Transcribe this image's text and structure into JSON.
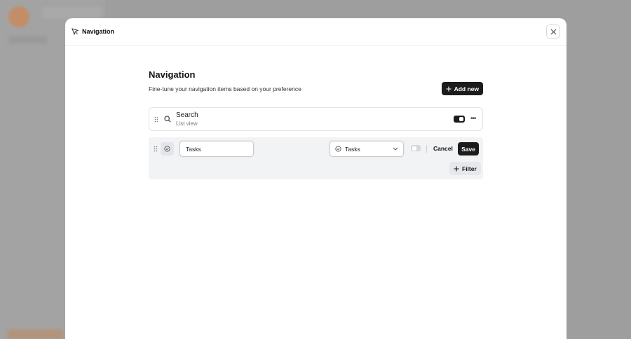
{
  "modal": {
    "header_title": "Navigation",
    "header_icon": "navigation-icon",
    "close_icon": "close-icon"
  },
  "page": {
    "title": "Navigation",
    "subtitle": "Fine-tune your navigation items based on your preference",
    "add_button_label": "Add new"
  },
  "items": [
    {
      "name": "Search",
      "view": "List view",
      "icon": "search-icon",
      "enabled": true,
      "more_icon": "more-horizontal-icon"
    }
  ],
  "editor": {
    "icon": "check-circle-icon",
    "name_value": "Tasks",
    "select_value": "Tasks",
    "select_icon": "check-circle-icon",
    "enabled": false,
    "cancel_label": "Cancel",
    "save_label": "Save",
    "filter_label": "Filter"
  },
  "colors": {
    "primary_button": "#1c1c1c",
    "editor_background": "#f1f3f5",
    "brand_accent": "#c98a5e"
  }
}
